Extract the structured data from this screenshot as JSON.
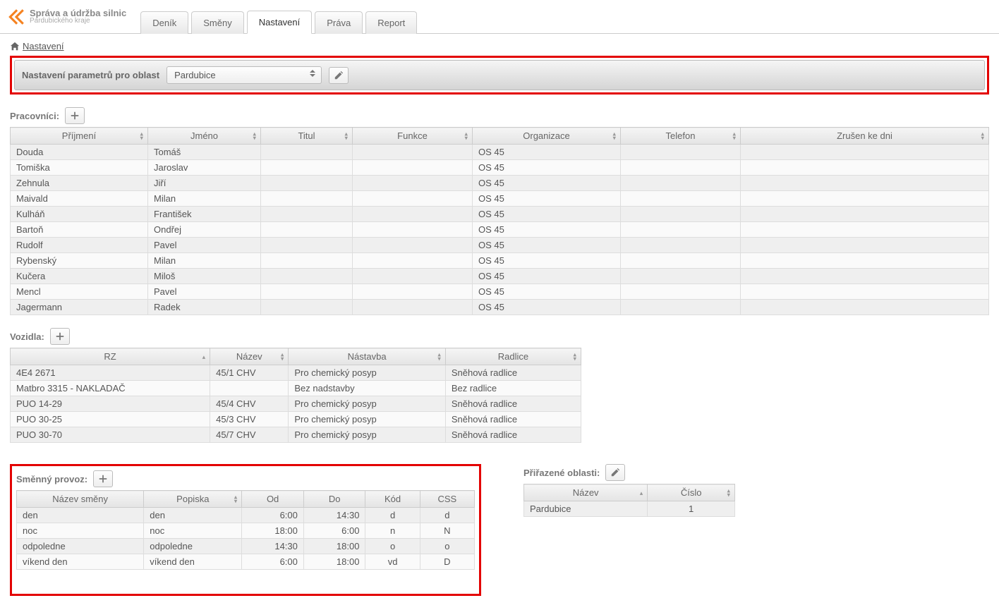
{
  "logo": {
    "main": "Správa a údržba silnic",
    "sub": "Pardubického kraje"
  },
  "tabs": [
    {
      "label": "Deník"
    },
    {
      "label": "Směny"
    },
    {
      "label": "Nastavení",
      "active": true
    },
    {
      "label": "Práva"
    },
    {
      "label": "Report"
    }
  ],
  "breadcrumb": {
    "label": "Nastavení"
  },
  "parambar": {
    "title": "Nastavení parametrů pro oblast",
    "selected": "Pardubice"
  },
  "workers": {
    "title": "Pracovníci:",
    "headers": [
      "Příjmení",
      "Jméno",
      "Titul",
      "Funkce",
      "Organizace",
      "Telefon",
      "Zrušen ke dni"
    ],
    "rows": [
      {
        "prijmeni": "Douda",
        "jmeno": "Tomáš",
        "titul": "",
        "funkce": "",
        "org": "OS 45",
        "tel": "",
        "zrusen": ""
      },
      {
        "prijmeni": "Tomiška",
        "jmeno": "Jaroslav",
        "titul": "",
        "funkce": "",
        "org": "OS 45",
        "tel": "",
        "zrusen": ""
      },
      {
        "prijmeni": "Zehnula",
        "jmeno": "Jiří",
        "titul": "",
        "funkce": "",
        "org": "OS 45",
        "tel": "",
        "zrusen": ""
      },
      {
        "prijmeni": "Maivald",
        "jmeno": "Milan",
        "titul": "",
        "funkce": "",
        "org": "OS 45",
        "tel": "",
        "zrusen": ""
      },
      {
        "prijmeni": "Kulháň",
        "jmeno": "František",
        "titul": "",
        "funkce": "",
        "org": "OS 45",
        "tel": "",
        "zrusen": ""
      },
      {
        "prijmeni": "Bartoň",
        "jmeno": "Ondřej",
        "titul": "",
        "funkce": "",
        "org": "OS 45",
        "tel": "",
        "zrusen": ""
      },
      {
        "prijmeni": "Rudolf",
        "jmeno": "Pavel",
        "titul": "",
        "funkce": "",
        "org": "OS 45",
        "tel": "",
        "zrusen": ""
      },
      {
        "prijmeni": "Rybenský",
        "jmeno": "Milan",
        "titul": "",
        "funkce": "",
        "org": "OS 45",
        "tel": "",
        "zrusen": ""
      },
      {
        "prijmeni": "Kučera",
        "jmeno": "Miloš",
        "titul": "",
        "funkce": "",
        "org": "OS 45",
        "tel": "",
        "zrusen": ""
      },
      {
        "prijmeni": "Mencl",
        "jmeno": "Pavel",
        "titul": "",
        "funkce": "",
        "org": "OS 45",
        "tel": "",
        "zrusen": ""
      },
      {
        "prijmeni": "Jagermann",
        "jmeno": "Radek",
        "titul": "",
        "funkce": "",
        "org": "OS 45",
        "tel": "",
        "zrusen": ""
      }
    ]
  },
  "vehicles": {
    "title": "Vozidla:",
    "headers": [
      "RZ",
      "Název",
      "Nástavba",
      "Radlice"
    ],
    "rows": [
      {
        "rz": "4E4 2671",
        "nazev": "45/1 CHV",
        "nastavba": "Pro chemický posyp",
        "radlice": "Sněhová radlice"
      },
      {
        "rz": "Matbro 3315 - NAKLADAČ",
        "nazev": "",
        "nastavba": "Bez nadstavby",
        "radlice": "Bez radlice"
      },
      {
        "rz": "PUO 14-29",
        "nazev": "45/4 CHV",
        "nastavba": "Pro chemický posyp",
        "radlice": "Sněhová radlice"
      },
      {
        "rz": "PUO 30-25",
        "nazev": "45/3 CHV",
        "nastavba": "Pro chemický posyp",
        "radlice": "Sněhová radlice"
      },
      {
        "rz": "PUO 30-70",
        "nazev": "45/7 CHV",
        "nastavba": "Pro chemický posyp",
        "radlice": "Sněhová radlice"
      }
    ]
  },
  "shifts": {
    "title": "Směnný provoz:",
    "headers": [
      "Název směny",
      "Popiska",
      "Od",
      "Do",
      "Kód",
      "CSS"
    ],
    "rows": [
      {
        "nazev": "den",
        "popis": "den",
        "od": "6:00",
        "do": "14:30",
        "kod": "d",
        "css": "d"
      },
      {
        "nazev": "noc",
        "popis": "noc",
        "od": "18:00",
        "do": "6:00",
        "kod": "n",
        "css": "N"
      },
      {
        "nazev": "odpoledne",
        "popis": "odpoledne",
        "od": "14:30",
        "do": "18:00",
        "kod": "o",
        "css": "o"
      },
      {
        "nazev": "víkend den",
        "popis": "víkend den",
        "od": "6:00",
        "do": "18:00",
        "kod": "vd",
        "css": "D"
      }
    ]
  },
  "areas": {
    "title": "Přiřazené oblasti:",
    "headers": [
      "Název",
      "Číslo"
    ],
    "rows": [
      {
        "nazev": "Pardubice",
        "cislo": "1"
      }
    ]
  }
}
